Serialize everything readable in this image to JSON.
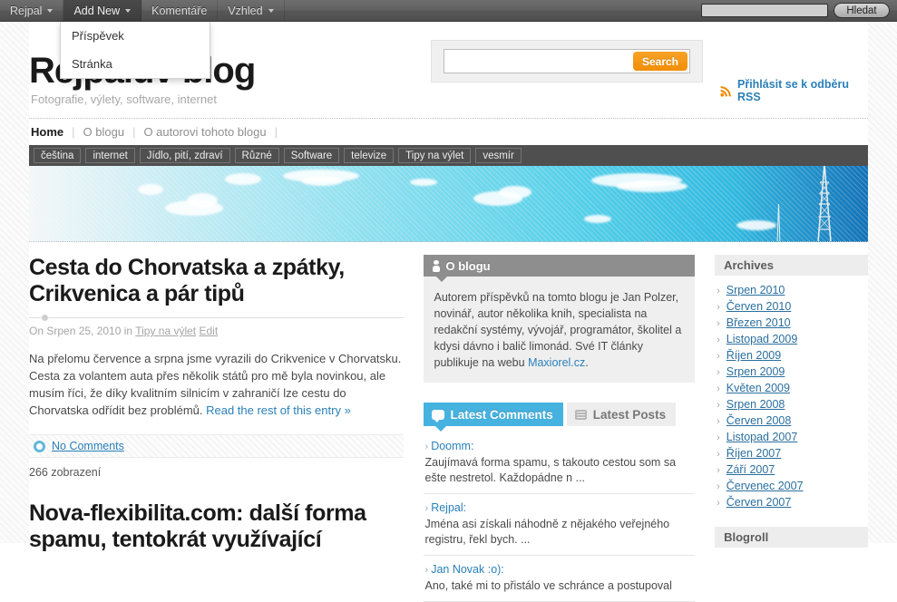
{
  "adminbar": {
    "items": [
      {
        "label": "Rejpal",
        "caret": true,
        "open": false
      },
      {
        "label": "Add New",
        "caret": true,
        "open": true
      },
      {
        "label": "Komentáře",
        "caret": false,
        "open": false
      },
      {
        "label": "Vzhled",
        "caret": true,
        "open": false
      }
    ],
    "dropdown": {
      "items": [
        {
          "label": "Příspěvek"
        },
        {
          "label": "Stránka"
        }
      ]
    },
    "search": {
      "value": "",
      "placeholder": "",
      "button_label": "Hledat"
    }
  },
  "header": {
    "site_title": "Rejpalův blog",
    "tagline": "Fotografie, výlety, software, internet",
    "search": {
      "value": "",
      "placeholder": "",
      "button_label": "Search"
    },
    "rss_label": "Přihlásit se k odběru RSS",
    "rss_icon": "rss-icon"
  },
  "nav": {
    "items": [
      {
        "label": "Home",
        "current": true
      },
      {
        "label": "O blogu",
        "current": false
      },
      {
        "label": "O autorovi tohoto blogu",
        "current": false
      }
    ]
  },
  "categories": [
    {
      "label": "čeština"
    },
    {
      "label": "internet"
    },
    {
      "label": "Jídlo, pití, zdraví"
    },
    {
      "label": "Různé"
    },
    {
      "label": "Software"
    },
    {
      "label": "televize"
    },
    {
      "label": "Tipy na výlet"
    },
    {
      "label": "vesmír"
    }
  ],
  "posts": [
    {
      "title": "Cesta do Chorvatska a zpátky, Crikvenica a pár tipů",
      "meta_prefix": "On Srpen 25, 2010 in",
      "meta_category": "Tipy na výlet",
      "meta_edit": "Edit",
      "body": "Na přelomu července a srpna jsme vyrazili do Crikvenice v Chorvatsku. Cesta za volantem auta přes několik států pro mě byla novinkou, ale musím říci, že díky kvalitním silnicím v zahraničí lze cestu do Chorvatska odřídit bez problémů.",
      "more_label": "Read the rest of this entry »",
      "comments_label": "No Comments",
      "views": "266 zobrazení"
    },
    {
      "title": "Nova-flexibilita.com: další forma spamu, tentokrát využívající"
    }
  ],
  "about_widget": {
    "icon": "person-icon",
    "title": "O blogu",
    "text_before": "Autorem příspěvků na tomto blogu je Jan Polzer, novinář, autor několika knih, specialista na redakční systémy, vývojář, programátor, školitel a kdysi dávno i balič limonád. Své IT články publikuje na webu ",
    "link_label": "Maxiorel.cz",
    "text_after": "."
  },
  "tabs": [
    {
      "label": "Latest Comments",
      "icon": "chat-icon",
      "active": true
    },
    {
      "label": "Latest Posts",
      "icon": "list-icon",
      "active": false
    }
  ],
  "comments": [
    {
      "author": "Doomm:",
      "text": "Zaujímavá forma spamu, s takouto cestou som sa ešte nestretol. Každopádne n ..."
    },
    {
      "author": "Rejpal:",
      "text": "Jména asi získali náhodně z nějakého veřejného registru, řekl bych. ..."
    },
    {
      "author": "Jan Novak :o):",
      "text": "Ano, také mi to přistálo ve schránce a postupoval"
    }
  ],
  "archives": {
    "title": "Archives",
    "items": [
      {
        "label": "Srpen 2010"
      },
      {
        "label": "Červen 2010"
      },
      {
        "label": "Březen 2010"
      },
      {
        "label": "Listopad 2009"
      },
      {
        "label": "Říjen 2009"
      },
      {
        "label": "Srpen 2009"
      },
      {
        "label": "Květen 2009"
      },
      {
        "label": "Srpen 2008"
      },
      {
        "label": "Červen 2008"
      },
      {
        "label": "Listopad 2007"
      },
      {
        "label": "Říjen 2007"
      },
      {
        "label": "Září 2007"
      },
      {
        "label": "Červenec 2007"
      },
      {
        "label": "Červen 2007"
      }
    ]
  },
  "blogroll": {
    "title": "Blogroll"
  },
  "colors": {
    "accent_blue": "#2a80b9",
    "tab_active": "#45b2e0",
    "search_orange": "#f18e06",
    "adminbar": "#585858",
    "catbar": "#4f4f4f"
  }
}
